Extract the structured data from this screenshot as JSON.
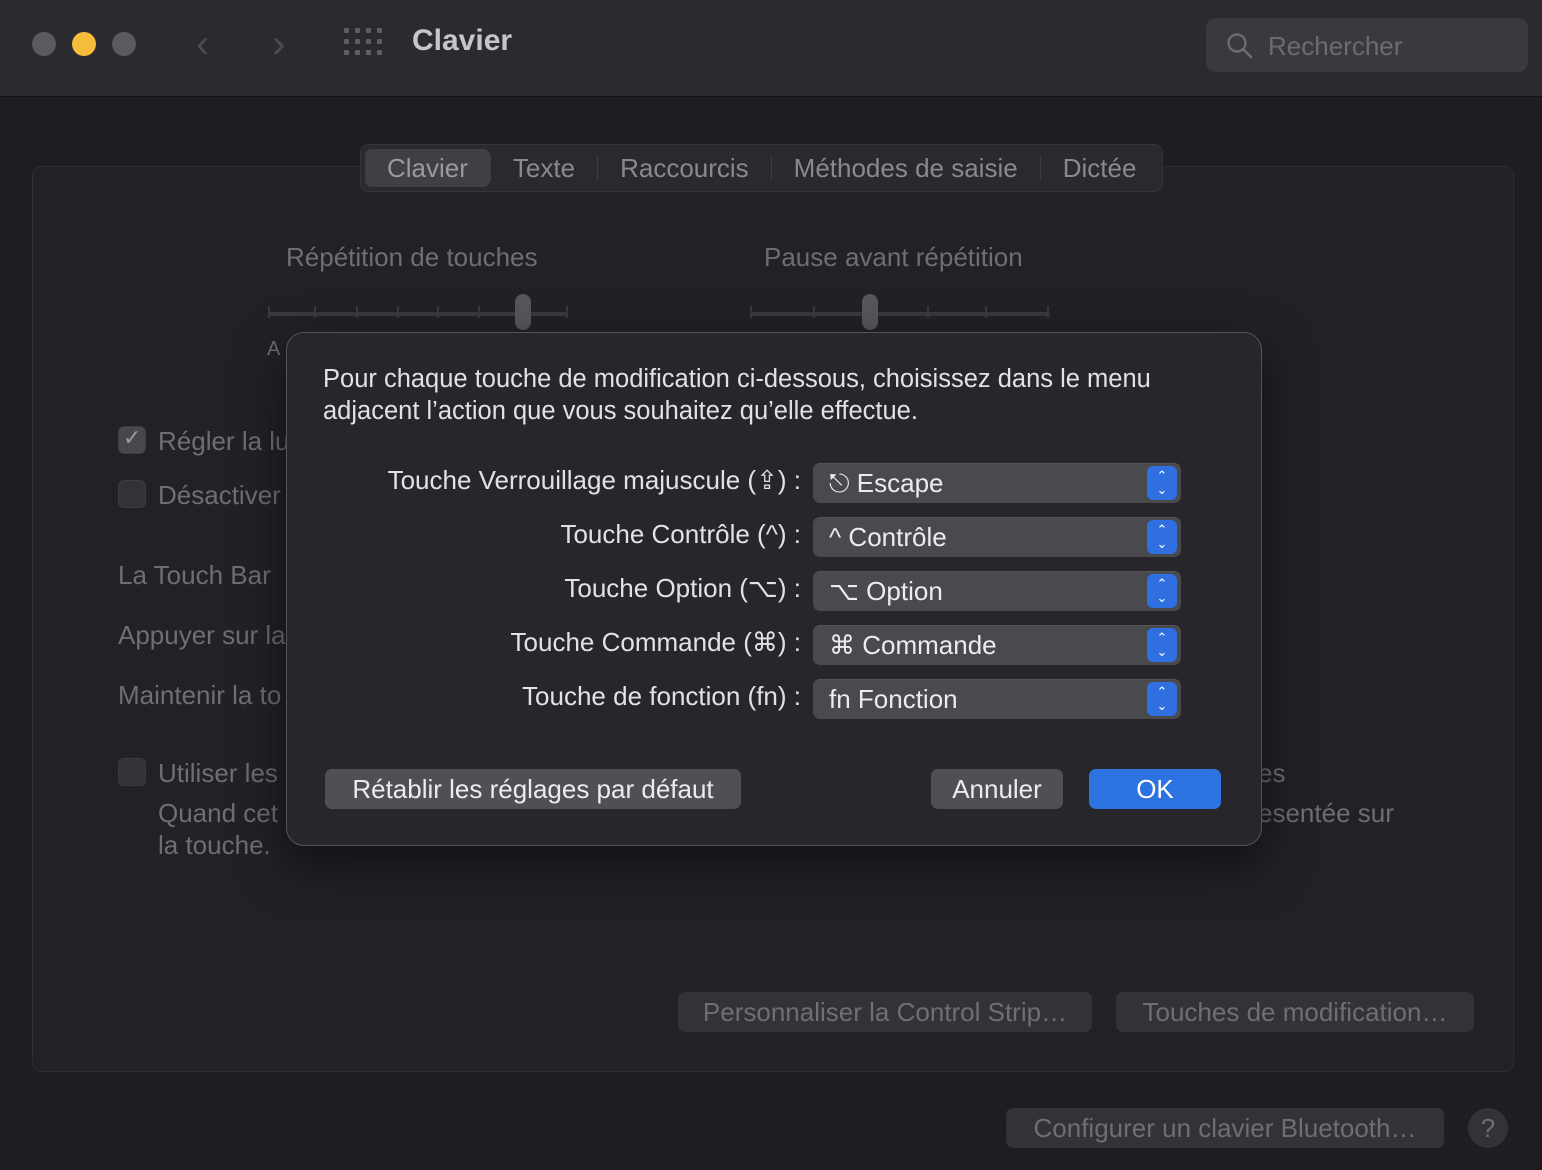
{
  "window": {
    "title": "Clavier",
    "search_placeholder": "Rechercher",
    "back_icon": "chevron-left-icon",
    "forward_icon": "chevron-right-icon"
  },
  "tabs": [
    {
      "label": "Clavier",
      "active": true
    },
    {
      "label": "Texte",
      "active": false
    },
    {
      "label": "Raccourcis",
      "active": false
    },
    {
      "label": "Méthodes de saisie",
      "active": false
    },
    {
      "label": "Dictée",
      "active": false
    }
  ],
  "background": {
    "key_repeat_label": "Répétition de touches",
    "delay_label": "Pause avant répétition",
    "key_repeat_level": 0.85,
    "delay_level": 0.4,
    "slider_fragment": "A",
    "checkbox_brightness": {
      "label": "Régler la lu",
      "checked": true
    },
    "checkbox_disable": {
      "label": "Désactiver",
      "checked": false
    },
    "touchbar_text": "La Touch Bar",
    "press_text": "Appuyer sur la",
    "hold_text": "Maintenir la to",
    "checkbox_use": {
      "label": "Utiliser les",
      "checked": false
    },
    "use_line2": "Quand cet",
    "use_line3": "la touche.",
    "right_fragment_1": "es",
    "right_fragment_2": "esentée sur",
    "btn_control_strip": "Personnaliser la Control Strip…",
    "btn_modifier_keys": "Touches de modification…",
    "btn_bluetooth": "Configurer un clavier Bluetooth…",
    "help": "?"
  },
  "sheet": {
    "intro": "Pour chaque touche de modification ci-dessous, choisissez dans le menu adjacent l’action que vous souhaitez qu’elle effectue.",
    "rows": [
      {
        "label": "Touche Verrouillage majuscule (⇪) :",
        "value": "⎋ Escape"
      },
      {
        "label": "Touche Contrôle (^) :",
        "value": "^ Contrôle"
      },
      {
        "label": "Touche Option (⌥) :",
        "value": "⌥ Option"
      },
      {
        "label": "Touche Commande (⌘) :",
        "value": "⌘ Commande"
      },
      {
        "label": "Touche de fonction (fn) :",
        "value": "fn Fonction"
      }
    ],
    "restore_button": "Rétablir les réglages par défaut",
    "cancel_button": "Annuler",
    "ok_button": "OK"
  },
  "colors": {
    "accent": "#2c72e0",
    "close_light": "#5b5a5f",
    "minimize_light": "#f6bd3a"
  }
}
